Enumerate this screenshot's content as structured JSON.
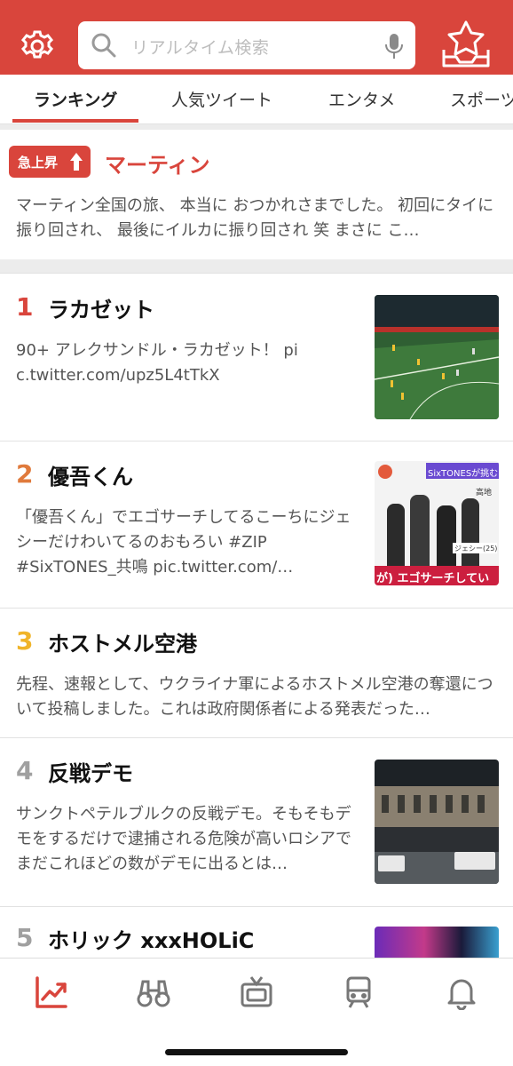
{
  "search": {
    "placeholder": "リアルタイム検索"
  },
  "tabs": [
    {
      "label": "ランキング",
      "active": true
    },
    {
      "label": "人気ツイート",
      "active": false
    },
    {
      "label": "エンタメ",
      "active": false
    },
    {
      "label": "スポーツ",
      "active": false
    }
  ],
  "rising": {
    "badge": "急上昇",
    "title": "マーティン",
    "text": "マーティン全国の旅、 本当に おつかれさまでした。 初回にタイに振り回され、 最後にイルカに振り回され 笑 まさに こ…"
  },
  "ranking": [
    {
      "rank": "1",
      "title": "ラカゼット",
      "desc": "90+ アレクサンドル・ラカゼット！ pic.twitter.com/upz5L4tTkX",
      "thumb": "soccer-match-thumbnail"
    },
    {
      "rank": "2",
      "title": "優吾くん",
      "desc": "「優吾くん」でエゴサーチしてるこーちにジェシーだけわいてるのおもろい #ZIP #SixTONES_共鳴 pic.twitter.com/…",
      "thumb": "tv-show-thumbnail",
      "thumb_texts": {
        "top": "SixTONESが挑む",
        "caption": "が) エゴサーチしてい",
        "name": "ジェシー(25)",
        "side": "高地"
      }
    },
    {
      "rank": "3",
      "title": "ホストメル空港",
      "desc": "先程、速報として、ウクライナ軍によるホストメル空港の奪還について投稿しました。これは政府関係者による発表だった…"
    },
    {
      "rank": "4",
      "title": "反戦デモ",
      "desc": "サンクトペテルブルクの反戦デモ。そもそもデモをするだけで逮捕される危険が高いロシアでまだこれほどの数がデモに出るとは…",
      "thumb": "protest-crowd-thumbnail"
    },
    {
      "rank": "5",
      "title": "ホリック xxxHOLiC",
      "desc": "",
      "thumb": "movie-poster-thumbnail"
    }
  ],
  "colors": {
    "accent": "#d9453c",
    "rank1": "#d9453c",
    "rank2": "#e07a3c",
    "rank3": "#f0b429",
    "rank_other": "#a0a0a0"
  },
  "nav": [
    {
      "name": "trend-chart-icon",
      "active": true
    },
    {
      "name": "binoculars-icon",
      "active": false
    },
    {
      "name": "tv-icon",
      "active": false
    },
    {
      "name": "train-icon",
      "active": false
    },
    {
      "name": "bell-icon",
      "active": false
    }
  ]
}
